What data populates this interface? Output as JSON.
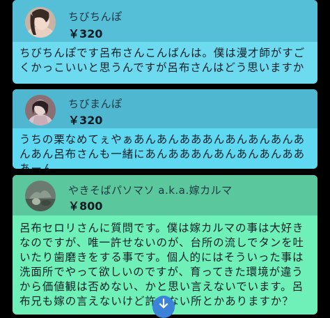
{
  "cards": [
    {
      "name": "ちびちんぽ",
      "amount": "￥320",
      "message": "ちびちんぽです呂布さんこんばんは。僕は漫才師がすごくかっこいいと思うんですが呂布さんはどう思いますか",
      "header_color": "#55bfd8",
      "body_color": "#6ddaf0"
    },
    {
      "name": "ちびまんぽ",
      "amount": "￥320",
      "message": "うちの栗なめてぇやぁあんあんあああんあんあんあんあんあん呂布さんも一緒にあんあああんあんあんあんあああーん",
      "header_color": "#4fb7cf",
      "body_color": "#5fd8f2"
    },
    {
      "name": "やきそばパソマソ a.k.a.嫁カルマ",
      "amount": "￥800",
      "message": "呂布セロリさんに質問です。僕は嫁カルマの事は大好きなのですが、唯一許せないのが、台所の流しでタンを吐いたり歯磨きをする事です。個人的にはそういった事は洗面所でやって欲しいのですが、育ってきた環境が違うから価値観は否めない、かと思い言えないでいます。呂布兄も嫁の言えないけど許せない所とかありますか？",
      "header_color": "#5bc79c",
      "body_color": "#6ef0b8"
    }
  ],
  "scroll_button": {
    "icon": "arrow-down-icon",
    "color": "#3b82d8"
  }
}
